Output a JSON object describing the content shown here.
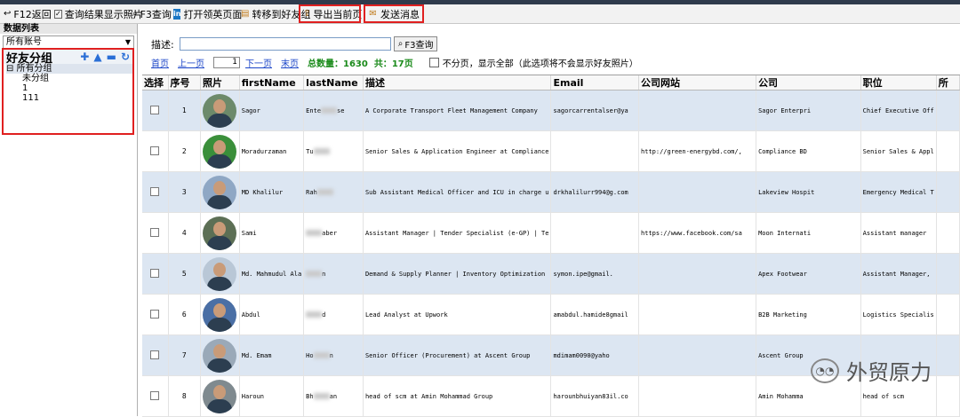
{
  "toolbar": {
    "items": [
      {
        "icon": "back-icon",
        "label": "F12返回"
      },
      {
        "icon": "checkbox-icon",
        "label": "查询结果显示照片"
      },
      {
        "icon": "search-icon",
        "label": "F3查询"
      },
      {
        "icon": "linkedin-icon",
        "label": "打开领英页面"
      },
      {
        "icon": "move-icon",
        "label": "转移到好友组"
      },
      {
        "icon": "export-icon",
        "label": "导出当前页"
      },
      {
        "icon": "message-icon",
        "label": "发送消息"
      }
    ]
  },
  "left_panel": {
    "title": "数据列表",
    "account_select": "所有账号",
    "group_title": "好友分组",
    "tree": [
      "所有分组",
      "未分组",
      "1",
      "111"
    ]
  },
  "search": {
    "label": "描述:",
    "value": "",
    "button": "F3查询"
  },
  "pager": {
    "first": "首页",
    "prev": "上一页",
    "page": "1",
    "next": "下一页",
    "last": "末页",
    "total_label": "总数量：",
    "total": "1630",
    "pages_label": "共：",
    "pages": "17页",
    "no_paging": "不分页，显示全部（此选项将不会显示好友照片）"
  },
  "table": {
    "headers": [
      "选择",
      "序号",
      "照片",
      "firstName",
      "lastName",
      "描述",
      "Email",
      "公司网站",
      "公司",
      "职位",
      "所"
    ],
    "rows": [
      {
        "no": "1",
        "first": "Sagor",
        "last": "Ente",
        "last2": "se",
        "desc": "A Corporate Transport Fleet Management Company",
        "email": "sagorcarrentalser",
        "email2": "@ya",
        "site": "",
        "company": "Sagor Enterpri",
        "title": "Chief Executive Off"
      },
      {
        "no": "2",
        "first": "Moradurzaman",
        "last": "Tu",
        "last2": "",
        "desc": "Senior Sales & Application Engineer at Compliance",
        "email": "",
        "email2": "",
        "site": "http://green-energybd.com/,",
        "company": "Compliance BD",
        "title": "Senior Sales & Appl"
      },
      {
        "no": "3",
        "first": "MD Khalilur",
        "last": "Rah",
        "last2": "",
        "desc": "Sub Assistant Medical Officer and ICU in charge u",
        "email": "drkhalilurr994@g",
        "email2": ".com",
        "site": "",
        "company": "Lakeview Hospit",
        "title": "Emergency Medical T"
      },
      {
        "no": "4",
        "first": "Sami",
        "last": "",
        "last2": "aber",
        "desc": "Assistant Manager | Tender Specialist (e-GP) | Te",
        "email": "",
        "email2": "",
        "site": "https://www.facebook.com/sa",
        "company": "Moon Internati",
        "title": "Assistant manager"
      },
      {
        "no": "5",
        "first": "Md. Mahmudul Ala",
        "last": "",
        "last2": "n",
        "desc": "Demand & Supply Planner | Inventory Optimization",
        "email": "symon.ipe@gmail.",
        "email2": "",
        "site": "",
        "company": "Apex Footwear",
        "title": "Assistant Manager,"
      },
      {
        "no": "6",
        "first": "Abdul",
        "last": "",
        "last2": "d",
        "desc": "Lead Analyst at Upwork",
        "email": "amabdul.hamide8",
        "email2": "gmail",
        "site": "",
        "company": "B2B Marketing",
        "title": "Logistics Specialis"
      },
      {
        "no": "7",
        "first": "Md. Emam",
        "last": "Ho",
        "last2": "n",
        "desc": "Senior Officer (Procurement) at Ascent Group",
        "email": "mdimam0090@yaho",
        "email2": "",
        "site": "",
        "company": "Ascent Group",
        "title": ""
      },
      {
        "no": "8",
        "first": "Haroun",
        "last": "Bh",
        "last2": "an",
        "desc": "head of scm at Amin Mohammad Group",
        "email": "harounbhuiyan83",
        "email2": "il.co",
        "site": "",
        "company": "Amin Mohamma",
        "title": "head of scm"
      }
    ]
  },
  "watermark": "外贸原力",
  "colors": {
    "highlight": "#e02020",
    "row_alt": "#dce6f2",
    "link": "#1a44c8",
    "total": "#1a8a1a"
  }
}
